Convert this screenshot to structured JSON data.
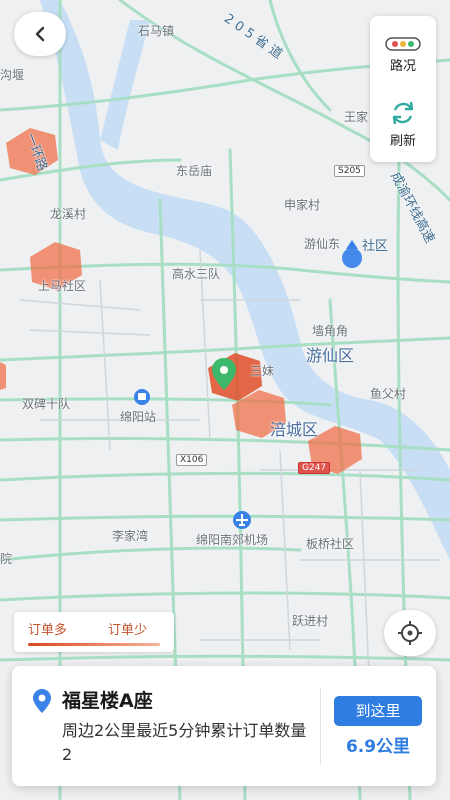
{
  "map": {
    "labels": [
      {
        "id": "shimazhen",
        "text": "石马镇"
      },
      {
        "id": "wangjia",
        "text": "王家"
      },
      {
        "id": "dongyuemiao",
        "text": "东岳庙"
      },
      {
        "id": "shenjiacun",
        "text": "申家村"
      },
      {
        "id": "longxicun",
        "text": "龙溪村"
      },
      {
        "id": "youxiandong",
        "text": "游仙东"
      },
      {
        "id": "gaoshuisandui",
        "text": "高水三队"
      },
      {
        "id": "shangmashequ",
        "text": "上马社区"
      },
      {
        "id": "qiangjiajiao",
        "text": "墙角角"
      },
      {
        "id": "xiaomei",
        "text": "三妹"
      },
      {
        "id": "shuangbeishidui",
        "text": "双碑十队"
      },
      {
        "id": "mianyangzhan",
        "text": "绵阳站"
      },
      {
        "id": "yufucun",
        "text": "鱼父村"
      },
      {
        "id": "lijiawan",
        "text": "李家湾"
      },
      {
        "id": "airport",
        "text": "绵阳南郊机场"
      },
      {
        "id": "banqiaoshequ",
        "text": "板桥社区"
      },
      {
        "id": "yuan",
        "text": "院"
      },
      {
        "id": "yuejincun",
        "text": "跃进村"
      },
      {
        "id": "goutang",
        "text": "沟堰"
      }
    ],
    "districts": [
      {
        "id": "youxianqu",
        "text": "游仙区"
      },
      {
        "id": "fuchengqu",
        "text": "涪城区"
      }
    ],
    "roads": [
      {
        "id": "s205prov",
        "text": "2 0 5 省 道"
      },
      {
        "id": "ring1",
        "text": "一环路"
      },
      {
        "id": "chengyu",
        "text": "成渝环线高速"
      },
      {
        "id": "shequ",
        "text": "社区"
      }
    ],
    "shields": [
      {
        "id": "s205",
        "text": "S205"
      },
      {
        "id": "x106",
        "text": "X106"
      },
      {
        "id": "g247",
        "text": "G247"
      }
    ],
    "colors": {
      "heat": "#f0704a",
      "pin": "#3cb96a",
      "road": "#a8dfc4",
      "water": "#c7def4",
      "user": "#3a82e8"
    }
  },
  "controls": {
    "back_icon": "chevron-left-icon",
    "traffic_label": "路况",
    "refresh_label": "刷新",
    "locate_icon": "crosshair-icon"
  },
  "legend": {
    "more": "订单多",
    "less": "订单少"
  },
  "card": {
    "title": "福星楼A座",
    "description": "周边2公里最近5分钟累计订单数量2",
    "go_button": "到这里",
    "distance": "6.9公里"
  }
}
